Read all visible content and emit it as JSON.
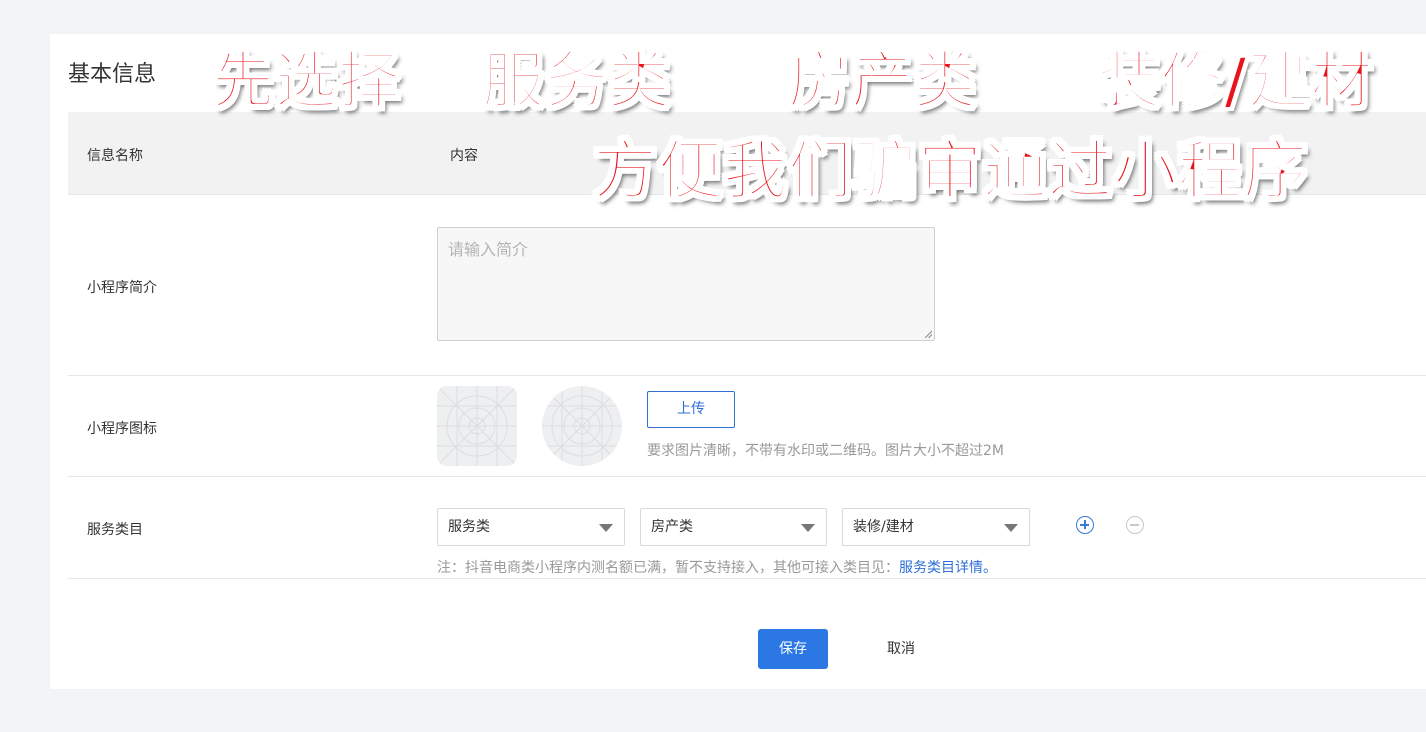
{
  "section": {
    "title": "基本信息"
  },
  "table_header": {
    "name_col": "信息名称",
    "content_col": "内容"
  },
  "intro": {
    "label": "小程序简介",
    "placeholder": "请输入简介",
    "value": ""
  },
  "icon": {
    "label": "小程序图标",
    "upload_label": "上传",
    "hint": "要求图片清晰，不带有水印或二维码。图片大小不超过2M"
  },
  "category": {
    "label": "服务类目",
    "selects": [
      {
        "value": "服务类"
      },
      {
        "value": "房产类"
      },
      {
        "value": "装修/建材"
      }
    ],
    "note_prefix": "注：抖音电商类小程序内测名额已满，暂不支持接入，其他可接入类目见：",
    "note_link": "服务类目详情。"
  },
  "actions": {
    "save_label": "保存",
    "cancel_label": "取消"
  },
  "overlay": {
    "line1": [
      "先选择",
      "服务类",
      "房产类",
      "装修/建材"
    ],
    "line2": "方便我们骗审通过小程序"
  },
  "colors": {
    "primary": "#2b78e4",
    "link": "#2f6fd6",
    "overlay_red": "#e8141c"
  }
}
